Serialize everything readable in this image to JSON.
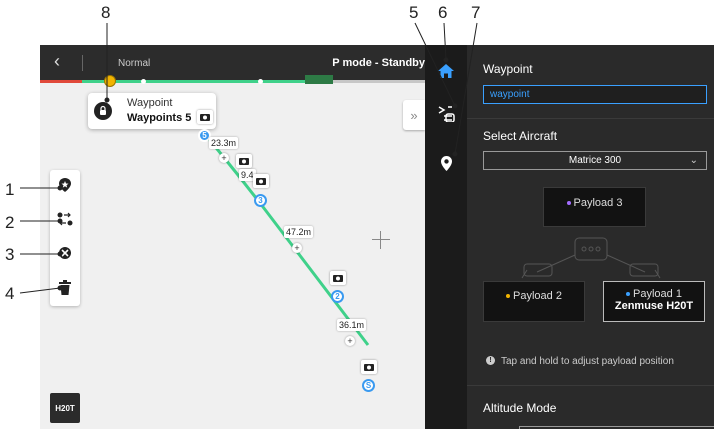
{
  "callouts": [
    "1",
    "2",
    "3",
    "4",
    "5",
    "6",
    "7",
    "8"
  ],
  "topbar": {
    "back_icon": "chevron-left-icon",
    "mode": "Normal",
    "status": "P mode - Standby"
  },
  "popup": {
    "line1": "Waypoint",
    "line2": "Waypoints 5"
  },
  "distances": [
    "23.3m",
    "9.4",
    "47.2m",
    "36.1m"
  ],
  "waypoints": [
    "5",
    "3",
    "2",
    "S"
  ],
  "h20t_badge": "H20T",
  "tools": [
    "add-waypoint-icon",
    "reverse-path-icon",
    "clear-waypoints-icon",
    "delete-icon"
  ],
  "panel": {
    "waypoint_header": "Waypoint",
    "waypoint_name": "waypoint",
    "aircraft_header": "Select Aircraft",
    "aircraft_value": "Matrice 300",
    "payload3": "Payload 3",
    "payload2": "Payload 2",
    "payload1": "Payload 1",
    "payload1_model": "Zenmuse H20T",
    "hint": "Tap and hold to adjust payload position",
    "altitude_header": "Altitude Mode"
  },
  "colors": {
    "route": "#3fd18a",
    "accent": "#3a9af0",
    "home": "#3aa0ff"
  }
}
